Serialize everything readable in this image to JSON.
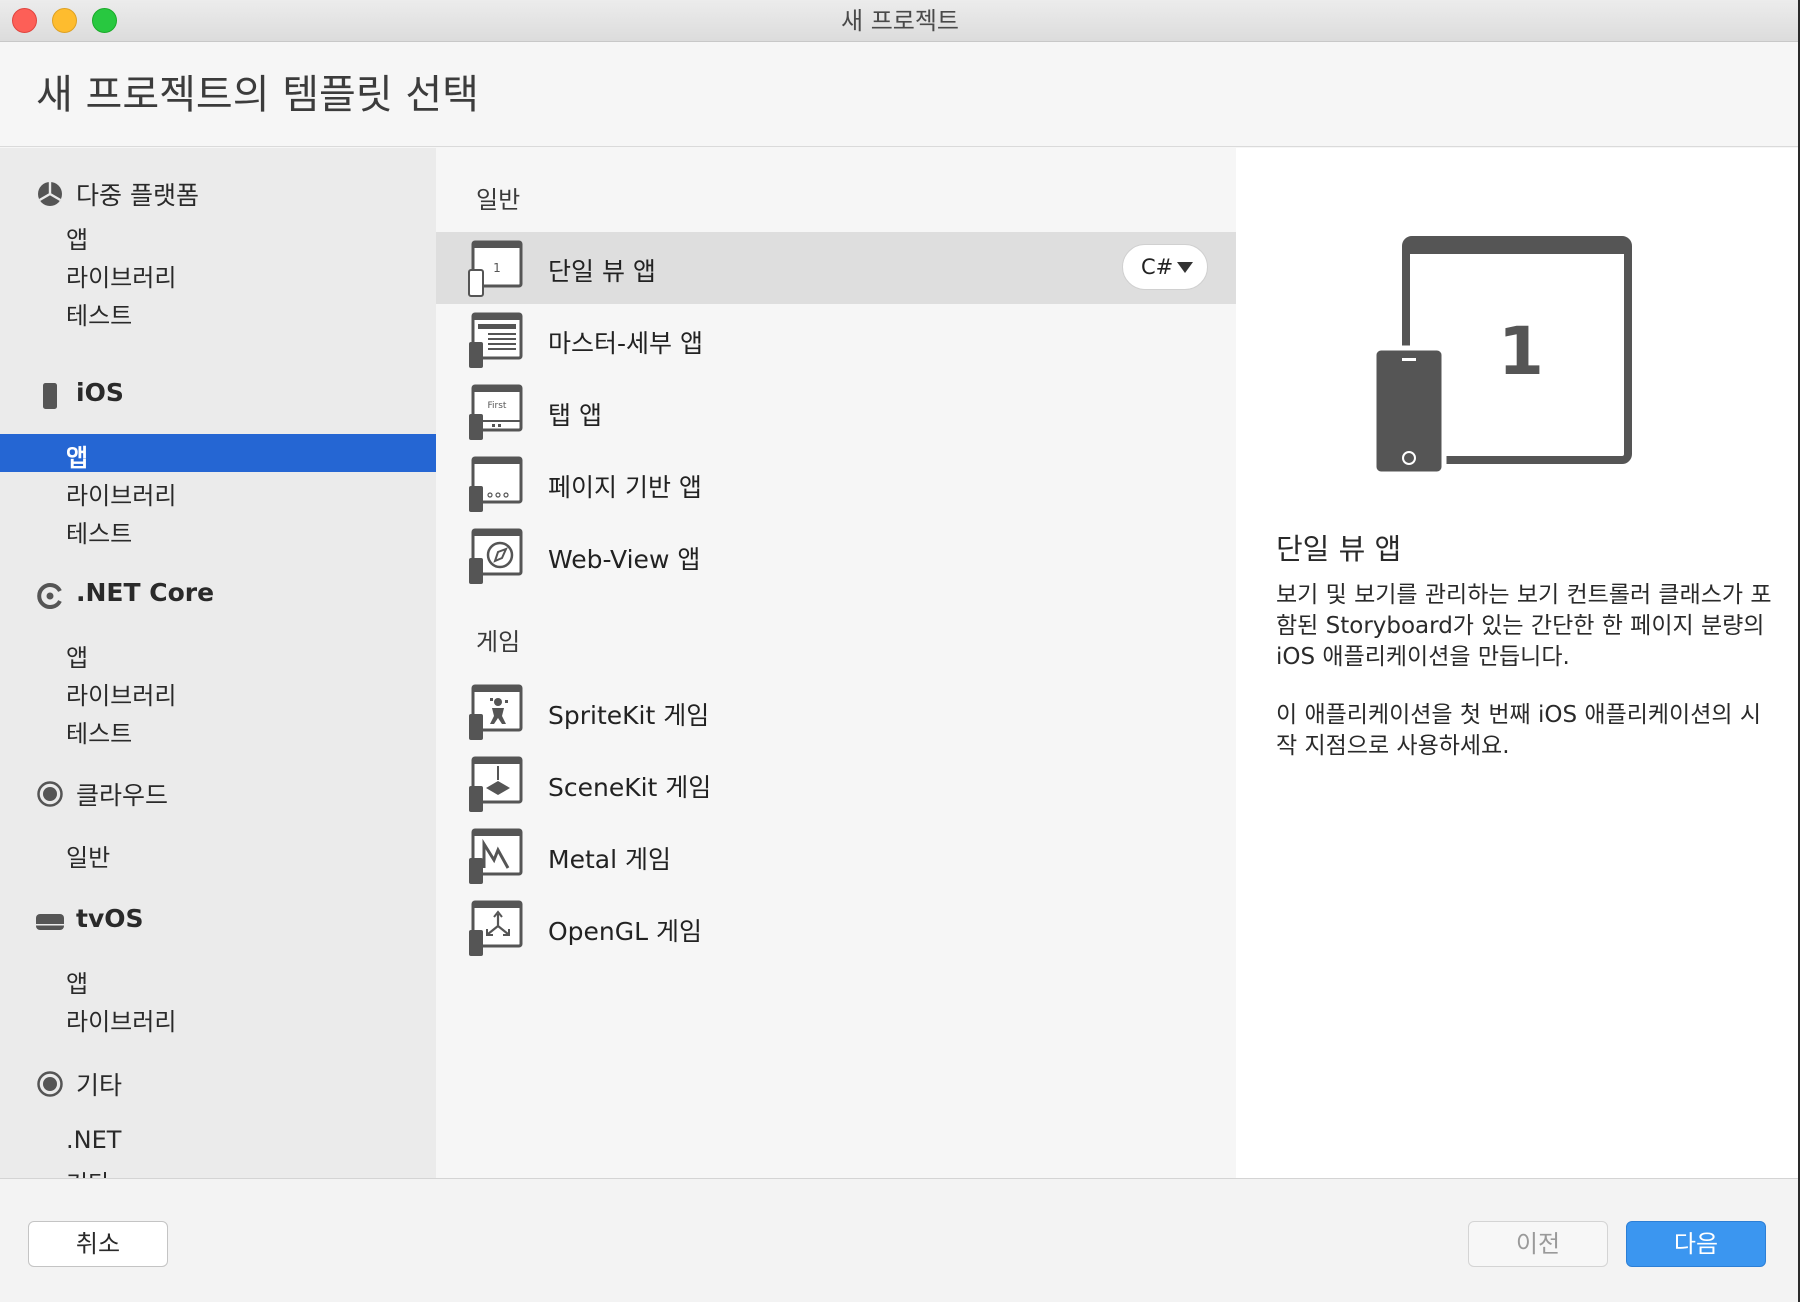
{
  "window": {
    "title": "새 프로젝트",
    "page_title": "새 프로젝트의 템플릿 선택"
  },
  "sidebar": {
    "categories": [
      {
        "label": "다중 플랫폼",
        "icon": "multiplatform-icon",
        "items": [
          "앱",
          "라이브러리",
          "테스트"
        ]
      },
      {
        "label": "iOS",
        "icon": "iphone-icon",
        "items": [
          "앱",
          "라이브러리",
          "테스트"
        ],
        "selected_item": "앱"
      },
      {
        "label": ".NET Core",
        "icon": "dotnet-core-icon",
        "items": [
          "앱",
          "라이브러리",
          "테스트"
        ]
      },
      {
        "label": "클라우드",
        "icon": "cloud-circle-icon",
        "items": [
          "일반"
        ]
      },
      {
        "label": "tvOS",
        "icon": "appletv-icon",
        "items": [
          "앱",
          "라이브러리"
        ]
      },
      {
        "label": "기타",
        "icon": "other-circle-icon",
        "items": [
          ".NET",
          "기타"
        ]
      }
    ]
  },
  "templates": {
    "sections": [
      {
        "heading": "일반",
        "items": [
          {
            "label": "단일 뷰 앱",
            "icon": "single-view-app-icon",
            "selected": true
          },
          {
            "label": "마스터-세부 앱",
            "icon": "master-detail-app-icon"
          },
          {
            "label": "탭 앱",
            "icon": "tabbed-app-icon",
            "icon_text": "First"
          },
          {
            "label": "페이지 기반 앱",
            "icon": "page-based-app-icon"
          },
          {
            "label": "Web-View 앱",
            "icon": "webview-app-icon"
          }
        ]
      },
      {
        "heading": "게임",
        "items": [
          {
            "label": "SpriteKit 게임",
            "icon": "spritekit-game-icon"
          },
          {
            "label": "SceneKit 게임",
            "icon": "scenekit-game-icon"
          },
          {
            "label": "Metal 게임",
            "icon": "metal-game-icon"
          },
          {
            "label": "OpenGL 게임",
            "icon": "opengl-game-icon"
          }
        ]
      }
    ],
    "language": "C#",
    "single_view_icon_number": "1"
  },
  "detail": {
    "title": "단일 뷰 앱",
    "preview_number": "1",
    "description": "보기 및 보기를 관리하는 보기 컨트롤러 클래스가 포함된 Storyboard가 있는 간단한 한 페이지 분량의 iOS 애플리케이션을 만듭니다.",
    "description2": "이 애플리케이션을 첫 번째 iOS 애플리케이션의 시작 지점으로 사용하세요."
  },
  "footer": {
    "cancel_label": "취소",
    "prev_label": "이전",
    "next_label": "다음"
  },
  "colors": {
    "selection_blue": "#2566d3",
    "primary_button": "#3b96f0",
    "icon_gray": "#555555"
  }
}
